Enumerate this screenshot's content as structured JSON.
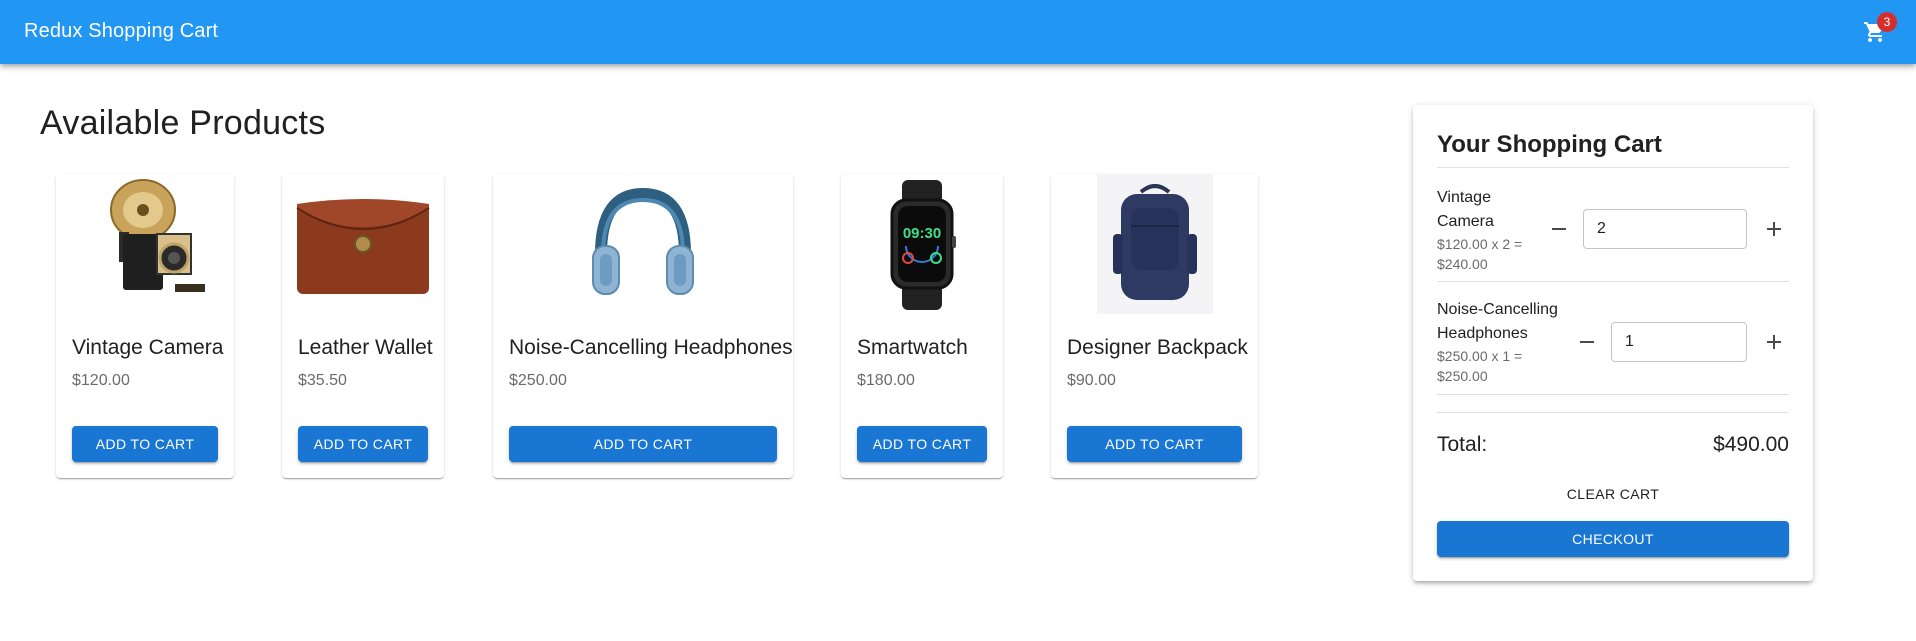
{
  "app": {
    "title": "Redux Shopping Cart",
    "cart_badge": "3",
    "accent": "#2196f3",
    "primary_button": "#1976d2",
    "badge_color": "#d32f2f"
  },
  "products": {
    "heading": "Available Products",
    "items": [
      {
        "name": "Vintage Camera",
        "price": "$120.00",
        "button": "ADD TO CART",
        "icon": "vintage-camera-image"
      },
      {
        "name": "Leather Wallet",
        "price": "$35.50",
        "button": "ADD TO CART",
        "icon": "leather-wallet-image"
      },
      {
        "name": "Noise-Cancelling Headphones",
        "price": "$250.00",
        "button": "ADD TO CART",
        "icon": "headphones-image"
      },
      {
        "name": "Smartwatch",
        "price": "$180.00",
        "button": "ADD TO CART",
        "icon": "smartwatch-image"
      },
      {
        "name": "Designer Backpack",
        "price": "$90.00",
        "button": "ADD TO CART",
        "icon": "backpack-image"
      }
    ]
  },
  "cart": {
    "title": "Your Shopping Cart",
    "items": [
      {
        "name_line1": "Vintage",
        "name_line2": "Camera",
        "subtotal_line1": "$120.00 x 2 =",
        "subtotal_line2": "$240.00",
        "quantity": "2"
      },
      {
        "name_line1": "Noise-Cancelling",
        "name_line2": "Headphones",
        "subtotal_line1": "$250.00 x 1 =",
        "subtotal_line2": "$250.00",
        "quantity": "1"
      }
    ],
    "total_label": "Total:",
    "total_value": "$490.00",
    "clear_label": "CLEAR CART",
    "checkout_label": "CHECKOUT"
  }
}
